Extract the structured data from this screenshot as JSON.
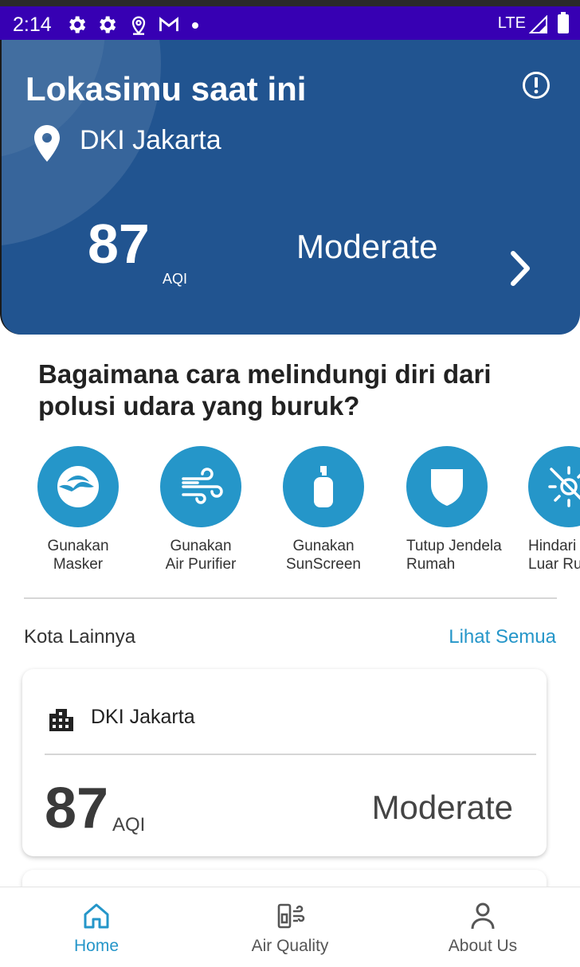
{
  "status_bar": {
    "time": "2:14",
    "network": "LTE"
  },
  "header": {
    "title": "Lokasimu saat ini",
    "location": "DKI Jakarta",
    "aqi_value": "87",
    "aqi_unit": "AQI",
    "aqi_status": "Moderate"
  },
  "protection": {
    "title": "Bagaimana cara melindungi diri dari polusi udara yang buruk?",
    "tips": [
      {
        "label_line1": "Gunakan",
        "label_line2": "Masker",
        "icon": "mask-icon"
      },
      {
        "label_line1": "Gunakan",
        "label_line2": "Air Purifier",
        "icon": "wind-icon"
      },
      {
        "label_line1": "Gunakan",
        "label_line2": "SunScreen",
        "icon": "bottle-icon"
      },
      {
        "label_line1": "Tutup Jendela",
        "label_line2": "Rumah",
        "icon": "shield-icon"
      },
      {
        "label_line1": "Hindari",
        "label_line2": "Luar Ru",
        "icon": "sun-off-icon"
      }
    ]
  },
  "other_cities": {
    "title": "Kota Lainnya",
    "see_all": "Lihat Semua",
    "cards": [
      {
        "city": "DKI Jakarta",
        "aqi": "87",
        "unit": "AQI",
        "status": "Moderate"
      }
    ]
  },
  "bottom_nav": {
    "items": [
      {
        "label": "Home",
        "icon": "home-icon",
        "active": true
      },
      {
        "label": "Air Quality",
        "icon": "air-quality-icon",
        "active": false
      },
      {
        "label": "About Us",
        "icon": "person-icon",
        "active": false
      }
    ]
  },
  "colors": {
    "status_bar": "#3700b3",
    "header_bg": "#215490",
    "accent": "#2596c9"
  }
}
